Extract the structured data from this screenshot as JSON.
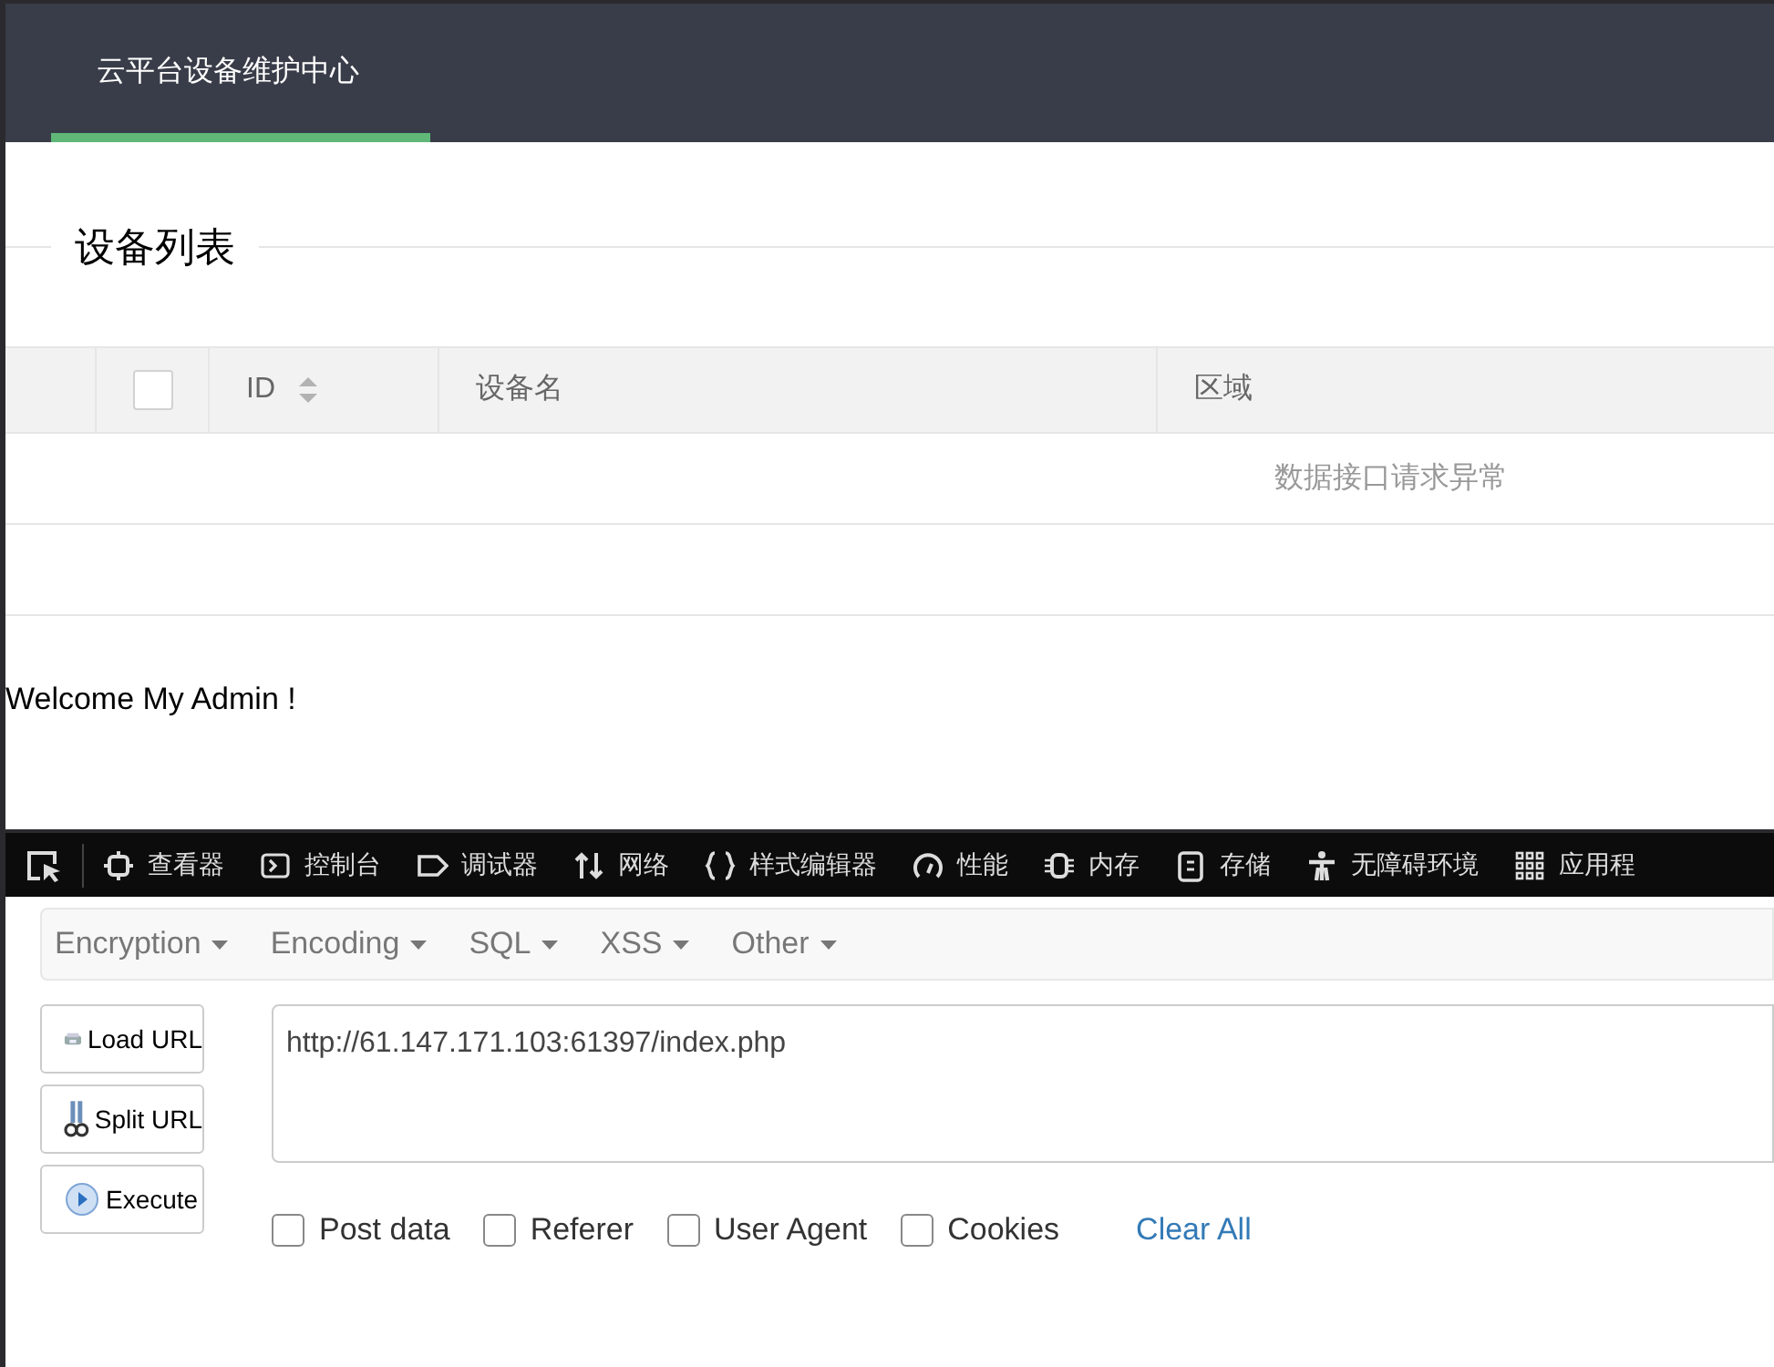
{
  "nav": {
    "items": [
      {
        "label": "云平台设备维护中心",
        "selected": true
      }
    ]
  },
  "section_title": "设备列表",
  "table": {
    "header_checkbox": {
      "checked": false
    },
    "columns": [
      {
        "label": "ID",
        "sortable": true
      },
      {
        "label": "设备名",
        "sortable": false
      },
      {
        "label": "区域",
        "sortable": false
      }
    ],
    "empty_message": "数据接口请求异常"
  },
  "welcome": "Welcome My Admin !",
  "devtools": {
    "tools": [
      {
        "label": "查看器"
      },
      {
        "label": "控制台"
      },
      {
        "label": "调试器"
      },
      {
        "label": "网络"
      },
      {
        "label": "样式编辑器"
      },
      {
        "label": "性能"
      },
      {
        "label": "内存"
      },
      {
        "label": "存储"
      },
      {
        "label": "无障碍环境"
      },
      {
        "label": "应用程"
      }
    ]
  },
  "hackbar": {
    "menus": [
      "Encryption",
      "Encoding",
      "SQL",
      "XSS",
      "Other"
    ],
    "buttons": [
      "Load URL",
      "Split URL",
      "Execute"
    ],
    "url": "http://61.147.171.103:61397/index.php",
    "options": [
      {
        "label": "Post data",
        "checked": false
      },
      {
        "label": "Referer",
        "checked": false
      },
      {
        "label": "User Agent",
        "checked": false
      },
      {
        "label": "Cookies",
        "checked": false
      }
    ],
    "clear_all": "Clear All"
  }
}
